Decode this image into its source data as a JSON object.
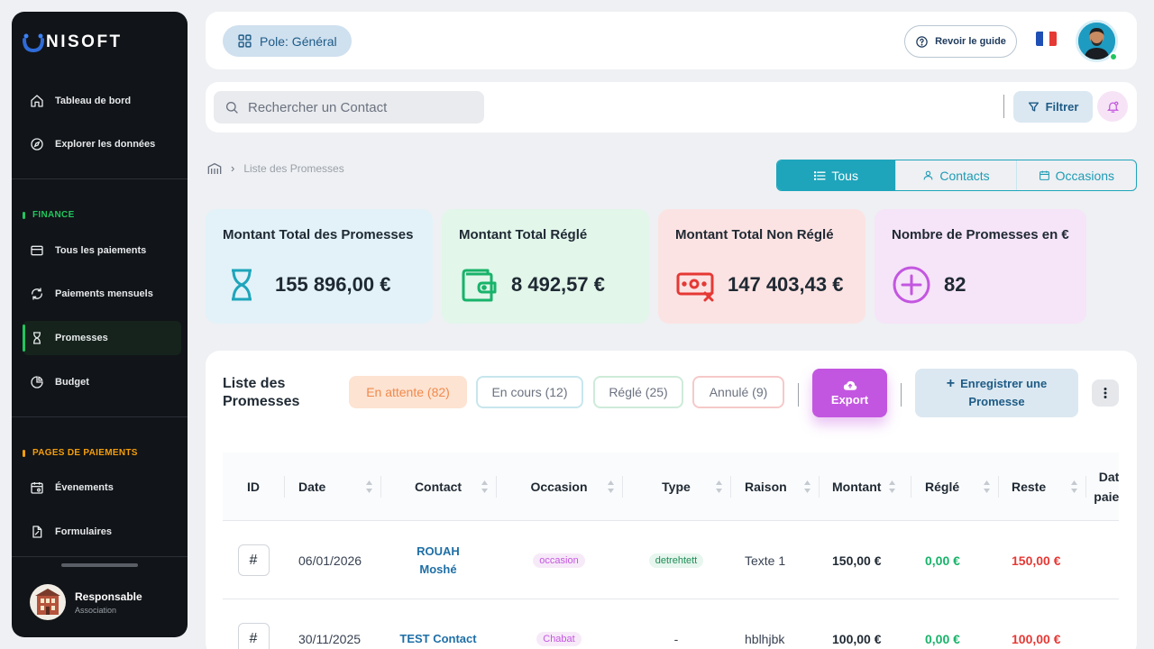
{
  "sidebar": {
    "logo_text": "NISOFT",
    "nav_main": [
      {
        "label": "Tableau de bord",
        "icon": "home-icon"
      },
      {
        "label": "Explorer les données",
        "icon": "compass-icon"
      }
    ],
    "finance_label": "FINANCE",
    "finance_items": [
      {
        "label": "Tous les paiements",
        "icon": "credit-card-icon"
      },
      {
        "label": "Paiements mensuels",
        "icon": "refresh-icon"
      },
      {
        "label": "Promesses",
        "icon": "hourglass-icon",
        "active": true
      },
      {
        "label": "Budget",
        "icon": "pie-chart-icon"
      }
    ],
    "pages_label": "PAGES DE PAIEMENTS",
    "pages_items": [
      {
        "label": "Évenements",
        "icon": "calendar-event-icon"
      },
      {
        "label": "Formulaires",
        "icon": "form-icon"
      }
    ],
    "profile": {
      "name": "Responsable",
      "role": "Association"
    }
  },
  "header": {
    "pole_label": "Pole: Général",
    "guide_label": "Revoir le guide"
  },
  "search": {
    "placeholder": "Rechercher un Contact",
    "filter_label": "Filtrer"
  },
  "breadcrumb": {
    "current": "Liste des Promesses"
  },
  "view_tabs": [
    {
      "label": "Tous",
      "active": true
    },
    {
      "label": "Contacts",
      "active": false
    },
    {
      "label": "Occasions",
      "active": false
    }
  ],
  "stats": [
    {
      "title": "Montant Total des Promesses",
      "value": "155 896,00 €",
      "icon": "hourglass-icon",
      "color": "#1ea5bb"
    },
    {
      "title": "Montant Total Réglé",
      "value": "8 492,57 €",
      "icon": "wallet-icon",
      "color": "#18b36a"
    },
    {
      "title": "Montant Total Non Réglé",
      "value": "147 403,43 €",
      "icon": "money-cancel-icon",
      "color": "#e53935"
    },
    {
      "title": "Nombre de Promesses en €",
      "value": "82",
      "icon": "plus-circle-icon",
      "color": "#c356e0"
    }
  ],
  "panel": {
    "title": "Liste des Promesses",
    "filters": [
      {
        "label": "En attente (82)"
      },
      {
        "label": "En cours (12)"
      },
      {
        "label": "Réglé (25)"
      },
      {
        "label": "Annulé (9)"
      }
    ],
    "export_label": "Export",
    "add_label": "Enregistrer une Promesse"
  },
  "table": {
    "columns": [
      "ID",
      "Date",
      "Contact",
      "Occasion",
      "Type",
      "Raison",
      "Montant",
      "Réglé",
      "Reste",
      "Date de paiement"
    ],
    "rows": [
      {
        "id": "#",
        "date": "06/01/2026",
        "contact": "ROUAH Moshé",
        "occasion": "occasion",
        "type": "detrehtett",
        "raison": "Texte 1",
        "montant": "150,00 €",
        "regle": "0,00 €",
        "reste": "150,00 €"
      },
      {
        "id": "#",
        "date": "30/11/2025",
        "contact": "TEST Contact",
        "occasion": "Chabat",
        "type": "-",
        "raison": "hblhjbk",
        "montant": "100,00 €",
        "regle": "0,00 €",
        "reste": "100,00 €"
      }
    ]
  },
  "colors": {
    "accent_teal": "#1ea5bb",
    "accent_green": "#22c55e",
    "accent_purple": "#c356e0",
    "finance_label": "#22c55e",
    "pages_label": "#f59e0b"
  }
}
